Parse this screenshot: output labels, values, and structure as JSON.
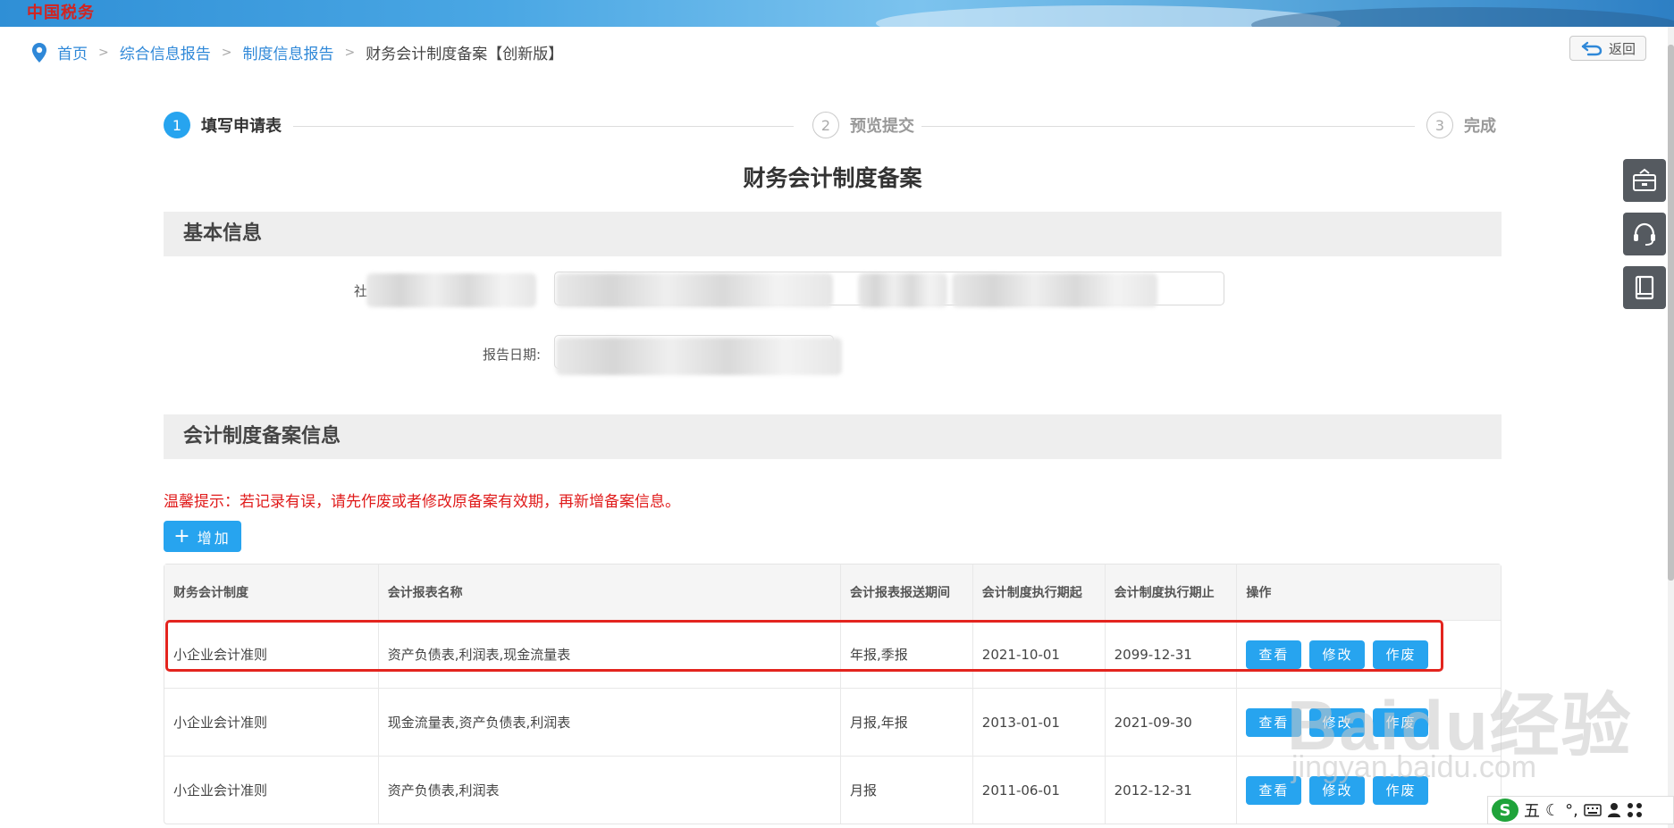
{
  "banner": {
    "logo": "中国税务"
  },
  "breadcrumb": {
    "items": [
      "首页",
      "综合信息报告",
      "制度信息报告"
    ],
    "current": "财务会计制度备案【创新版】",
    "separator": ">"
  },
  "back_label": "返回",
  "steps": [
    {
      "num": "1",
      "label": "填写申请表",
      "state": "active"
    },
    {
      "num": "2",
      "label": "预览提交",
      "state": "idle"
    },
    {
      "num": "3",
      "label": "完成",
      "state": "idle"
    }
  ],
  "page_title": "财务会计制度备案",
  "sections": {
    "basic": "基本信息",
    "filing": "会计制度备案信息"
  },
  "fields": {
    "credit_code_label_visible": "社",
    "report_date_label": "报告日期:"
  },
  "tip": "温馨提示：若记录有误，请先作废或者修改原备案有效期，再新增备案信息。",
  "add_button": {
    "icon": "+",
    "label": "增加"
  },
  "table": {
    "headers": [
      "财务会计制度",
      "会计报表名称",
      "会计报表报送期间",
      "会计制度执行期起",
      "会计制度执行期止",
      "操作"
    ],
    "rows": [
      {
        "system": "小企业会计准则",
        "reports": "资产负债表,利润表,现金流量表",
        "period": "年报,季报",
        "start": "2021-10-01",
        "end": "2099-12-31"
      },
      {
        "system": "小企业会计准则",
        "reports": "现金流量表,资产负债表,利润表",
        "period": "月报,年报",
        "start": "2013-01-01",
        "end": "2021-09-30"
      },
      {
        "system": "小企业会计准则",
        "reports": "资产负债表,利润表",
        "period": "月报",
        "start": "2011-06-01",
        "end": "2012-12-31"
      }
    ],
    "actions": [
      "查看",
      "修改",
      "作废"
    ]
  },
  "side_tools": [
    "toolbox-icon",
    "headset-icon",
    "book-icon"
  ],
  "watermark": {
    "main": "Baidu经验",
    "sub": "jingyan.baidu.com"
  },
  "ime": {
    "brand": "S",
    "mode": "五",
    "punct": "°,",
    "moon": "☾"
  },
  "colors": {
    "accent": "#27a4ef",
    "tip": "#e01b1b",
    "highlight": "#e3241e"
  }
}
